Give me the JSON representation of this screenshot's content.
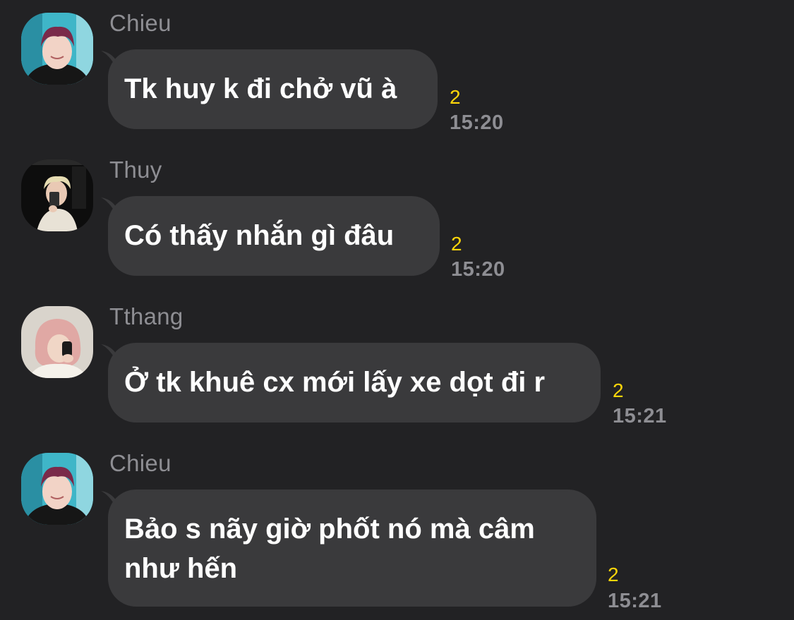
{
  "messages": [
    {
      "sender": "Chieu",
      "avatar": "avatar-chieu",
      "text_lines": [
        "Tk huy k đi chở vũ à"
      ],
      "read_count": "2",
      "time": "15:20"
    },
    {
      "sender": "Thuy",
      "avatar": "avatar-thuy",
      "text_lines": [
        "Có thấy nhắn gì đâu"
      ],
      "read_count": "2",
      "time": "15:20"
    },
    {
      "sender": "Tthang",
      "avatar": "avatar-tthang",
      "text_lines": [
        "Ở tk khuê cx mới lấy xe dọt đi r"
      ],
      "read_count": "2",
      "time": "15:21"
    },
    {
      "sender": "Chieu",
      "avatar": "avatar-chieu",
      "text_lines": [
        "Bảo s nãy giờ phốt nó mà câm",
        "như hến"
      ],
      "read_count": "2",
      "time": "15:21"
    }
  ],
  "colors": {
    "background": "#222224",
    "bubble": "#3a3a3c",
    "read_count": "#ffd60a",
    "muted_text": "#8e8e93"
  }
}
